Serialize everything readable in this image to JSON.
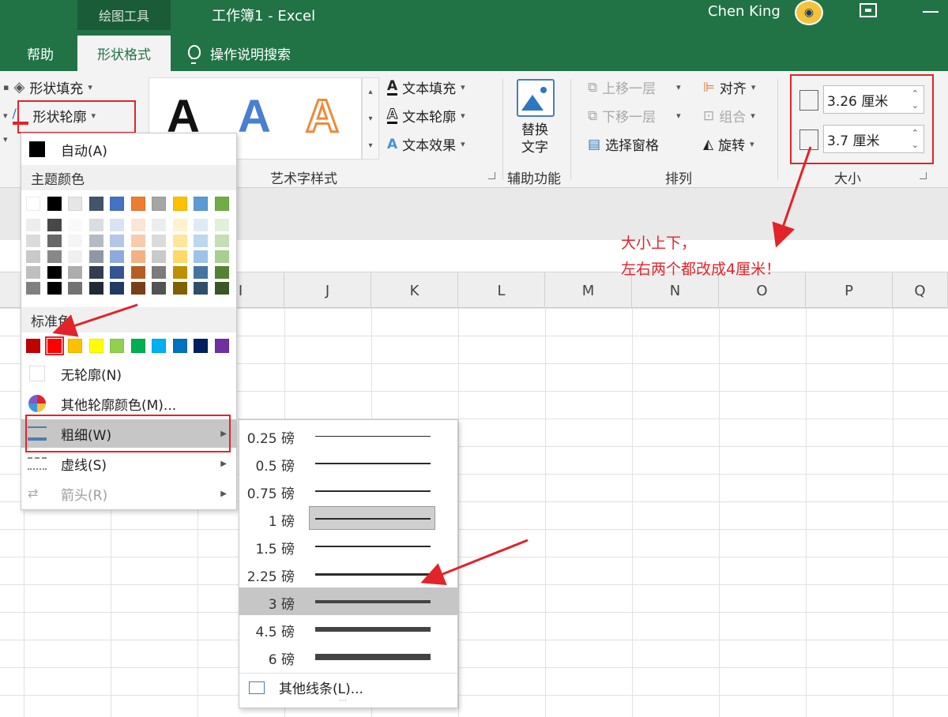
{
  "titlebar": {
    "context_tab": "绘图工具",
    "document_title": "工作簿1  -  Excel",
    "user_name": "Chen King"
  },
  "tabs": {
    "help": "帮助",
    "shape_format": "形状格式",
    "search": "操作说明搜索"
  },
  "ribbon": {
    "shape_fill": "形状填充",
    "shape_outline": "形状轮廓",
    "wordart_sample": "A",
    "text_fill": "文本填充",
    "text_outline": "文本轮廓",
    "text_effects": "文本效果",
    "wordart_group": "艺术字样式",
    "alt_text_line1": "替换",
    "alt_text_line2": "文字",
    "accessibility_group": "辅助功能",
    "bring_forward": "上移一层",
    "send_backward": "下移一层",
    "selection_pane": "选择窗格",
    "align": "对齐",
    "group": "组合",
    "rotate": "旋转",
    "arrange_group": "排列",
    "height_value": "3.26 厘米",
    "width_value": "3.7 厘米",
    "size_group": "大小"
  },
  "columns": [
    "I",
    "J",
    "K",
    "L",
    "M",
    "N",
    "O",
    "P",
    "Q"
  ],
  "annotation": {
    "line1": "大小上下，",
    "line2": "左右两个都改成4厘米！"
  },
  "outline_menu": {
    "automatic": "自动(A)",
    "theme_colors": "主题颜色",
    "standard_colors": "标准色",
    "no_outline": "无轮廓(N)",
    "more_colors": "其他轮廓颜色(M)...",
    "weight": "粗细(W)",
    "dashes": "虚线(S)",
    "arrows": "箭头(R)",
    "theme_top": [
      "#ffffff",
      "#000000",
      "#e7e6e6",
      "#44546a",
      "#4472c4",
      "#ed7d31",
      "#a5a5a5",
      "#ffc000",
      "#5b9bd5",
      "#70ad47"
    ],
    "standard": [
      "#c00000",
      "#ff0000",
      "#ffc000",
      "#ffff00",
      "#92d050",
      "#00b050",
      "#00b0f0",
      "#0070c0",
      "#002060",
      "#7030a0"
    ]
  },
  "weight_menu": {
    "items": [
      "0.25 磅",
      "0.5 磅",
      "0.75 磅",
      "1 磅",
      "1.5 磅",
      "2.25 磅",
      "3 磅",
      "4.5 磅",
      "6 磅"
    ],
    "more": "其他线条(L)..."
  }
}
